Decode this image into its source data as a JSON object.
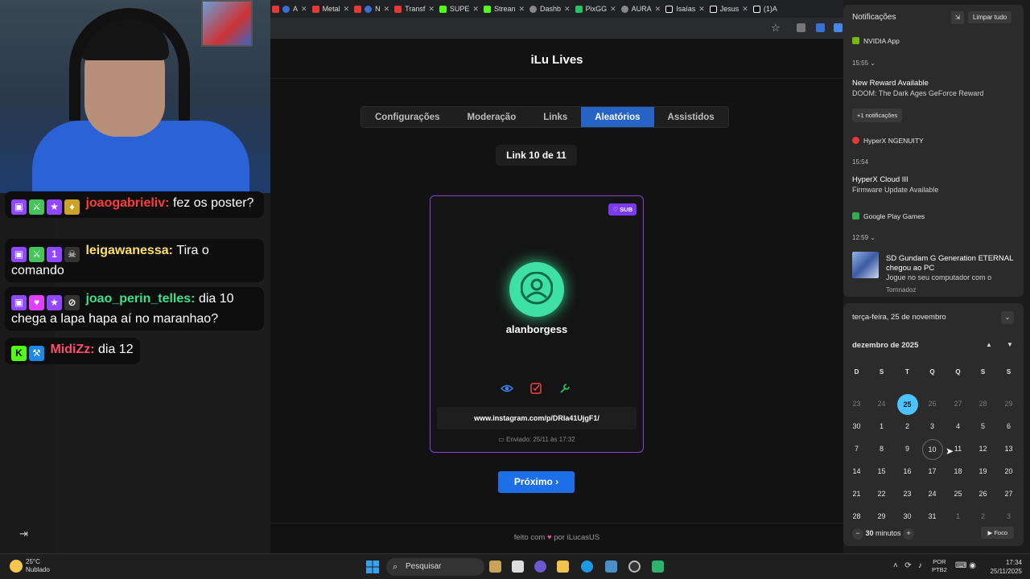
{
  "browser": {
    "tabs": [
      {
        "label": "A",
        "color": "#e53935"
      },
      {
        "label": "Metal",
        "color": "#e53935"
      },
      {
        "label": "N",
        "color": "#e53935"
      },
      {
        "label": "Transf",
        "color": "#e53935"
      },
      {
        "label": "SUPE",
        "color": "#53fc18"
      },
      {
        "label": "Strean",
        "color": "#53fc18"
      },
      {
        "label": "Dashb",
        "color": "#888888"
      },
      {
        "label": "PixGG",
        "color": "#22c55e"
      },
      {
        "label": "AURA",
        "color": "#888888"
      },
      {
        "label": "Isaías",
        "color": "#ffffff"
      },
      {
        "label": "Jesus",
        "color": "#ffffff"
      },
      {
        "label": "(1)A",
        "color": "#ffffff"
      }
    ]
  },
  "site": {
    "title": "iLu Lives",
    "tabs": [
      "Configurações",
      "Moderação",
      "Links",
      "Aleatórios",
      "Assistidos"
    ],
    "active_tab": "Aleatórios",
    "counter": "Link 10 de 11",
    "card": {
      "badge": "SUB",
      "username": "alanborgess",
      "link": "www.instagram.com/p/DRIa41UjgF1/",
      "sent": "Enviado: 25/11 às 17:32"
    },
    "next_label": "Próximo ›",
    "footer_pre": "feito com",
    "footer_post": "por iLucasUS"
  },
  "chat": [
    {
      "user": "joaogabrieliv:",
      "text": "fez os poster?",
      "color": "#ff3b3b"
    },
    {
      "user": "leigawanessa:",
      "text": "Tira o comando",
      "color": "#ffe066"
    },
    {
      "user": "joao_perin_telles:",
      "text": "dia 10 chega a lapa hapa aí no maranhao?",
      "color": "#3de08a"
    },
    {
      "user": "MidiZz:",
      "text": "dia 12",
      "color": "#ff4d6d"
    }
  ],
  "notifications": {
    "header": "Notificações",
    "clear": "Limpar tudo",
    "groups": [
      {
        "app": "NVIDIA App",
        "time": "15:55",
        "title": "New Reward Available",
        "body": "DOOM: The Dark Ages GeForce Reward",
        "more": "+1 notificações"
      },
      {
        "app": "HyperX NGENUITY",
        "time": "15:54",
        "title": "HyperX Cloud III",
        "body": "Firmware Update Available"
      },
      {
        "app": "Google Play Games",
        "time": "12:59",
        "title": "SD Gundam G Generation ETERNAL chegou ao PC",
        "body": "Jogue no seu computador com o",
        "extra": "Tornnadoz"
      }
    ]
  },
  "calendar": {
    "date_header": "terça-feira, 25 de novembro",
    "month": "dezembro de 2025",
    "weekdays": [
      "D",
      "S",
      "T",
      "Q",
      "Q",
      "S",
      "S"
    ],
    "weeks": [
      [
        "23",
        "24",
        "25",
        "26",
        "27",
        "28",
        "29"
      ],
      [
        "30",
        "1",
        "2",
        "3",
        "4",
        "5",
        "6"
      ],
      [
        "7",
        "8",
        "9",
        "10",
        "11",
        "12",
        "13"
      ],
      [
        "14",
        "15",
        "16",
        "17",
        "18",
        "19",
        "20"
      ],
      [
        "21",
        "22",
        "23",
        "24",
        "25",
        "26",
        "27"
      ],
      [
        "28",
        "29",
        "30",
        "31",
        "1",
        "2",
        "3"
      ]
    ],
    "focus_minutes": "30",
    "focus_unit": "minutos",
    "focus_label": "Foco"
  },
  "taskbar": {
    "temp": "25°C",
    "weather": "Nublado",
    "search": "Pesquisar",
    "lang1": "POR",
    "lang2": "PTB2",
    "time": "17:34",
    "date": "25/11/2025"
  }
}
